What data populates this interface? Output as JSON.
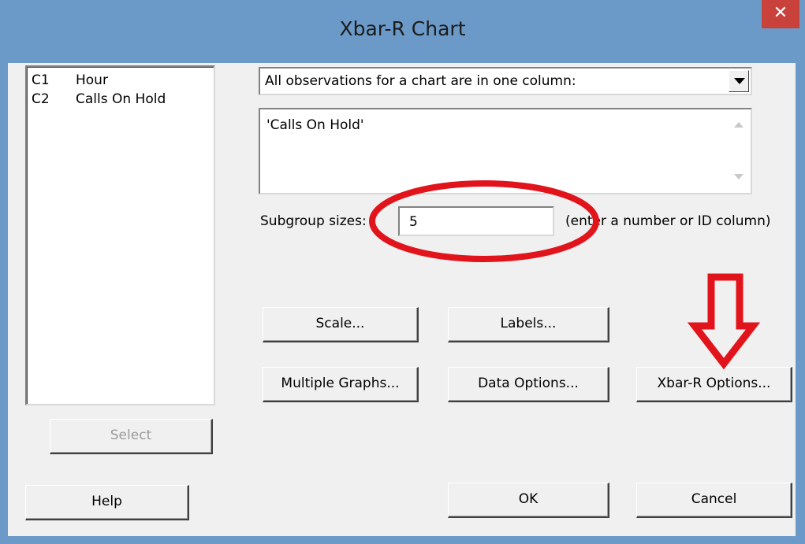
{
  "window": {
    "title": "Xbar-R Chart",
    "close_glyph": "✕"
  },
  "variables": [
    {
      "col": "C1",
      "name": "Hour"
    },
    {
      "col": "C2",
      "name": "Calls On Hold"
    }
  ],
  "data_layout": {
    "selected": "All observations for a chart are in one column:"
  },
  "columns_field": {
    "value": "'Calls On Hold'"
  },
  "subgroup": {
    "label": "Subgroup sizes:",
    "value": "5",
    "hint": "(enter a number or ID column)"
  },
  "buttons": {
    "select": "Select",
    "help": "Help",
    "scale": "Scale...",
    "labels": "Labels...",
    "multiple_graphs": "Multiple Graphs...",
    "data_options": "Data Options...",
    "xbar_r_options": "Xbar-R Options...",
    "ok": "OK",
    "cancel": "Cancel"
  },
  "colors": {
    "titlebar": "#6b9ac9",
    "close": "#c9413b",
    "annotation": "#e2141b",
    "dialog_bg": "#f0f0f0"
  },
  "icons": {
    "close": "close-icon",
    "dropdown": "chevron-down-icon",
    "scroll_up": "scroll-up-icon",
    "scroll_down": "scroll-down-icon",
    "arrow": "down-arrow-annotation"
  }
}
